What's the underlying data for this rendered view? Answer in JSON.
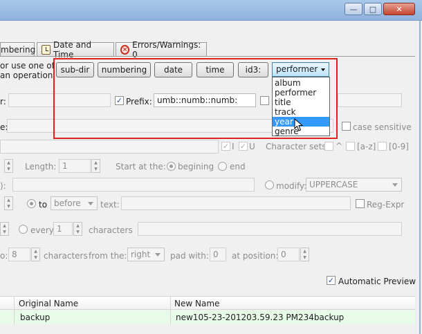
{
  "titlebar": {
    "minimize": "—",
    "maximize": "□",
    "close": "✕"
  },
  "tabs": [
    {
      "label": "mbering"
    },
    {
      "label": "Date and Time",
      "icon": "clock-icon"
    },
    {
      "label": "Errors/Warnings: 0",
      "icon": "error-icon"
    }
  ],
  "intro": {
    "line1": "or use one of",
    "line2": "an operation."
  },
  "tokens": [
    "sub-dir",
    "numbering",
    "date",
    "time",
    "id3:"
  ],
  "id3_select": {
    "selected": "performer",
    "options": [
      "album",
      "performer",
      "title",
      "track",
      "year",
      "genre"
    ],
    "highlighted": "year"
  },
  "row_prefix": {
    "left_label": "r:",
    "prefix_label": "Prefix:",
    "prefix_checked": true,
    "value": "umb::numb::numb:"
  },
  "row_replace": {
    "left_label": "e:",
    "case_label": "case sensitive"
  },
  "row_charsets": {
    "i_label": "I",
    "u_label": "U",
    "charsets_label": "Character sets:",
    "caret": "^",
    "az": "[a-z]",
    "digits": "[0-9]"
  },
  "row_length": {
    "length_label": "Length:",
    "length_value": "1",
    "start_label": "Start at the:",
    "beginning_label": "begining",
    "end_label": "end"
  },
  "row_modify": {
    "left_label": "):",
    "modify_label": "modify:",
    "modify_value": "UPPERCASE"
  },
  "row_insert": {
    "to_label": "to",
    "position": "before",
    "text_label": "text:",
    "regex_label": "Reg-Expr"
  },
  "row_every": {
    "every_label": "every",
    "every_value": "1",
    "characters_label": "characters"
  },
  "row_pad": {
    "left_label": "o:",
    "count": "8",
    "characters_label": "characters",
    "from_label": "from the:",
    "side": "right",
    "pad_label": "pad with:",
    "pad_value": "0",
    "at_label": "at position:",
    "at_value": "0"
  },
  "preview": {
    "auto_label": "Automatic Preview",
    "checked": true
  },
  "list": {
    "headers": [
      "Original Name",
      "New Name"
    ],
    "rows": [
      {
        "original": "backup",
        "new": "new105-23-201203.59.23 PM234backup"
      }
    ]
  }
}
